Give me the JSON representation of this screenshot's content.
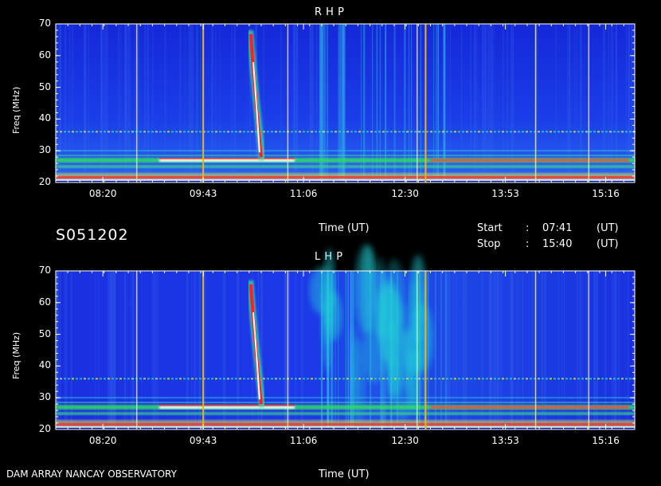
{
  "header": {
    "station_id": "S051202",
    "footer": "DAM ARRAY   NANCAY OBSERVATORY"
  },
  "time_info": {
    "start_label": "Start",
    "start_sep": ":",
    "start_value": "07:41",
    "start_unit": "(UT)",
    "stop_label": "Stop",
    "stop_sep": ":",
    "stop_value": "15:40",
    "stop_unit": "(UT)"
  },
  "colors": {
    "background": "#000000",
    "spectrum_base": "#1a2fe0",
    "spectrum_bright": "#ff2020",
    "marker": "#e8e8b0"
  },
  "chart_data": [
    {
      "type": "heatmap",
      "title": "R H P",
      "xlabel": "Time (UT)",
      "ylabel": "Freq (MHz)",
      "yticks": [
        "70",
        "60",
        "50",
        "40",
        "30",
        "20"
      ],
      "xticks": [
        "08:20",
        "09:43",
        "11:06",
        "12:30",
        "13:53",
        "15:16"
      ],
      "ylim": [
        20,
        70
      ],
      "xlim": [
        "07:41",
        "15:40"
      ],
      "burst": {
        "time_center": "10:27",
        "freq_range": [
          27,
          68
        ],
        "type": "type III"
      },
      "bands": [
        25,
        27,
        36
      ]
    },
    {
      "type": "heatmap",
      "title": "L H P",
      "xlabel": "Time (UT)",
      "ylabel": "Freq (MHz)",
      "yticks": [
        "70",
        "60",
        "50",
        "40",
        "30",
        "20"
      ],
      "xticks": [
        "08:20",
        "09:43",
        "11:06",
        "12:30",
        "13:53",
        "15:16"
      ],
      "ylim": [
        20,
        70
      ],
      "xlim": [
        "07:41",
        "15:40"
      ],
      "burst": {
        "time_center": "10:27",
        "freq_range": [
          27,
          67
        ],
        "type": "type III"
      },
      "bands": [
        25,
        27,
        36
      ]
    }
  ]
}
